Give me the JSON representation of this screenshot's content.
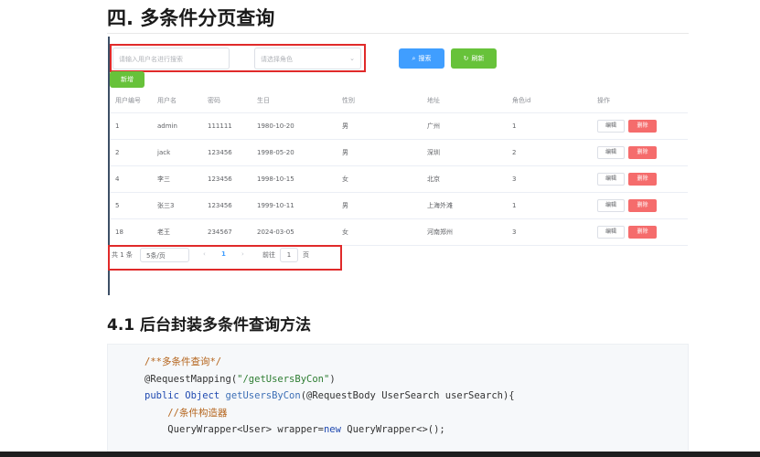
{
  "section_title": "四. 多条件分页查询",
  "toolbar": {
    "search_placeholder": "请输入用户名进行搜索",
    "select_placeholder": "请选择角色",
    "search_label": "搜索",
    "refresh_label": "刷新",
    "add_label": "新增"
  },
  "table": {
    "headers": [
      "用户编号",
      "用户名",
      "密码",
      "生日",
      "性别",
      "地址",
      "角色id",
      "操作"
    ],
    "rows": [
      [
        "1",
        "admin",
        "111111",
        "1980-10-20",
        "男",
        "广州",
        "1"
      ],
      [
        "2",
        "jack",
        "123456",
        "1998-05-20",
        "男",
        "深圳",
        "2"
      ],
      [
        "4",
        "李三",
        "123456",
        "1998-10-15",
        "女",
        "北京",
        "3"
      ],
      [
        "5",
        "张三3",
        "123456",
        "1999-10-11",
        "男",
        "上海外滩",
        "1"
      ],
      [
        "18",
        "老王",
        "234567",
        "2024-03-05",
        "女",
        "河南郑州",
        "3"
      ]
    ],
    "edit_label": "编辑",
    "delete_label": "删除"
  },
  "pagination": {
    "total": "共 1 条",
    "page_size": "5条/页",
    "prev": "‹",
    "current": "1",
    "next": "›",
    "goto_label": "前往",
    "goto_value": "1",
    "page_suffix": "页"
  },
  "subsection_title": "4.1 后台封装多条件查询方法",
  "code": {
    "l1": "/**多条件查询*/",
    "l2_ann": "@RequestMapping(",
    "l2_str": "\"/getUsersByCon\"",
    "l2_end": ")",
    "l3_kw1": "public",
    "l3_type": " Object ",
    "l3_fn": "getUsersByCon",
    "l3_rest": "(@RequestBody UserSearch userSearch){",
    "l4": "//条件构造器",
    "l5_a": "QueryWrapper<User> wrapper=",
    "l5_kw": "new",
    "l5_b": " QueryWrapper<>();"
  },
  "colors": {
    "primary": "#409eff",
    "success": "#67c23a",
    "danger": "#f56c6c",
    "highlight_box": "#e02a2a"
  }
}
